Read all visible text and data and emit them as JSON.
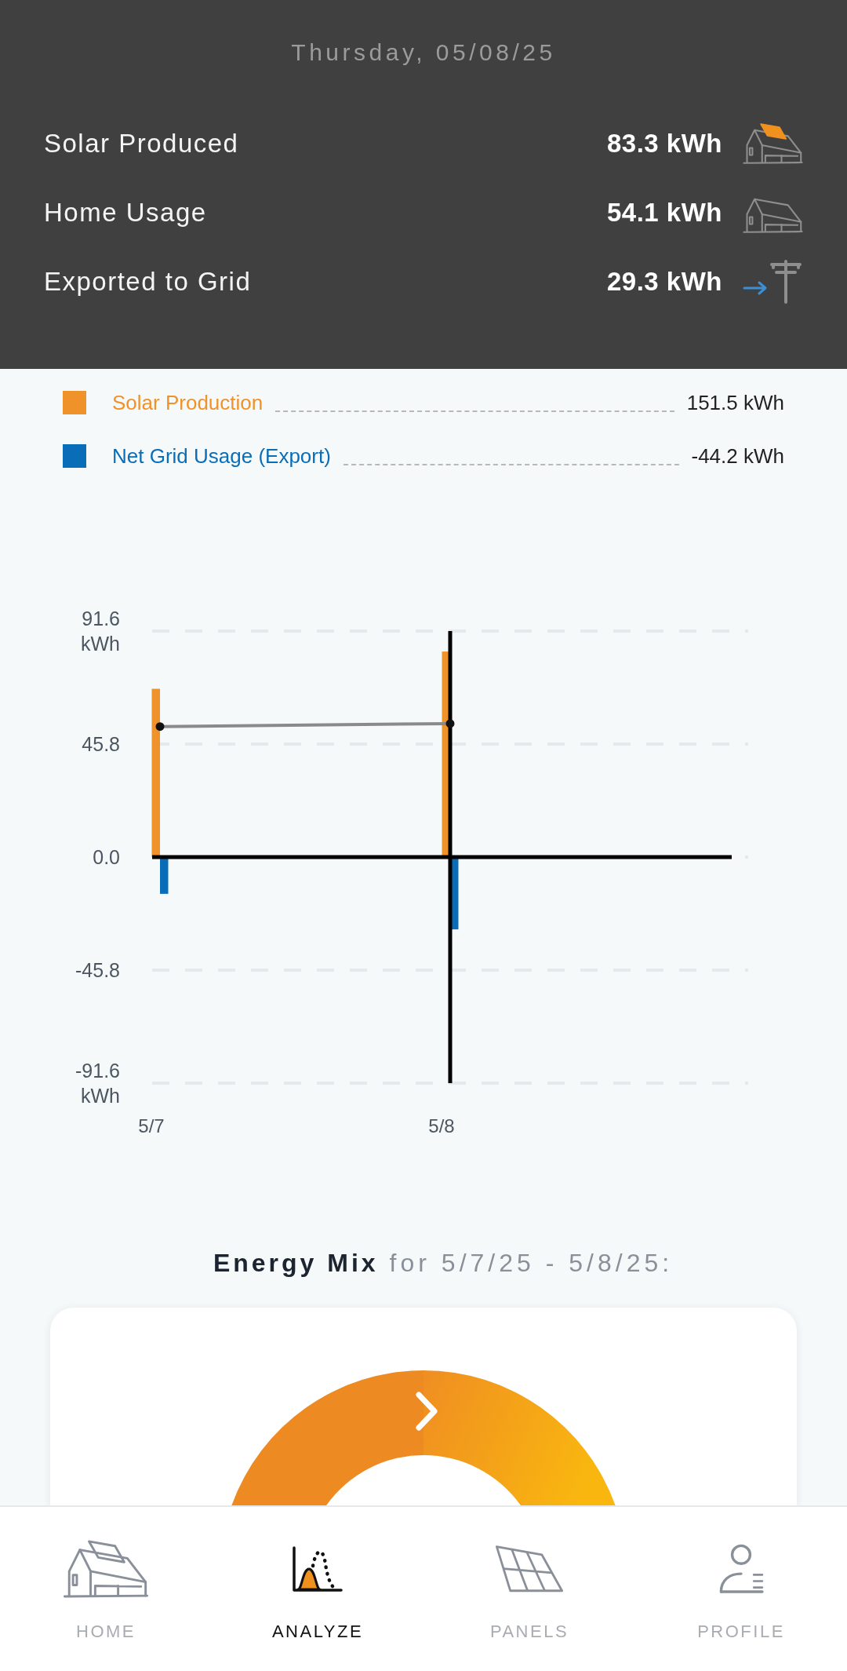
{
  "header": {
    "date": "Thursday, 05/08/25",
    "stats": [
      {
        "kind": "solar-house",
        "label": "Solar Produced",
        "value": "83.3 kWh"
      },
      {
        "kind": "house",
        "label": "Home Usage",
        "value": "54.1 kWh"
      },
      {
        "kind": "grid-export",
        "label": "Exported to Grid",
        "value": "29.3 kWh"
      }
    ]
  },
  "legend": [
    {
      "label": "Solar Production",
      "total": "151.5 kWh",
      "color": "#f0922a"
    },
    {
      "label": "Net Grid Usage (Export)",
      "total": "-44.2 kWh",
      "color": "#0a6db8"
    }
  ],
  "chart": {
    "chart_data": {
      "type": "bar",
      "categories": [
        "5/7",
        "5/8"
      ],
      "series": [
        {
          "color": "#f0922a",
          "values": [
            68.2,
            83.3
          ]
        },
        {
          "color": "#0a6db8",
          "values": [
            -14.9,
            -29.3
          ]
        },
        {
          "type": "line",
          "color": "#8a8a8a",
          "marker": "circle",
          "values": [
            52.9,
            54.1
          ]
        }
      ],
      "ylim": [
        -91.6,
        91.6
      ],
      "yticks": [
        {
          "value": 91.6,
          "label": "91.6 kWh"
        },
        {
          "value": 45.8,
          "label": "45.8"
        },
        {
          "value": 0,
          "label": "0.0"
        },
        {
          "value": -45.8,
          "label": "-45.8"
        },
        {
          "value": -91.6,
          "label": "-91.6 kWh"
        }
      ],
      "grid": true,
      "ref_lines": [
        {
          "axis": "x",
          "value": "5/8",
          "color": "#000000"
        }
      ]
    }
  },
  "energy_mix": {
    "title": "Energy Mix",
    "subtitle": "for 5/7/25 - 5/8/25:"
  },
  "nav": [
    {
      "kind": "home",
      "label": "HOME",
      "selected": false
    },
    {
      "kind": "analyze",
      "label": "ANALYZE",
      "selected": true
    },
    {
      "kind": "panels",
      "label": "PANELS",
      "selected": false
    },
    {
      "kind": "profile",
      "label": "PROFILE",
      "selected": false
    }
  ]
}
